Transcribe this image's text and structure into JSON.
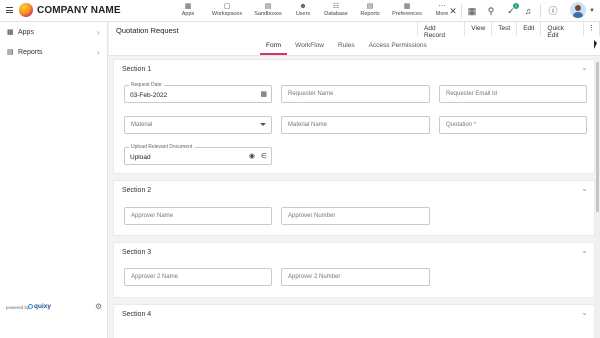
{
  "app": {
    "brand": "COMPANY NAME"
  },
  "topnav": [
    {
      "label": "Apps",
      "icon": "apps-icon"
    },
    {
      "label": "Workspaces",
      "icon": "workspaces-icon"
    },
    {
      "label": "Sandboxes",
      "icon": "sandboxes-icon"
    },
    {
      "label": "Users",
      "icon": "users-icon"
    },
    {
      "label": "Database",
      "icon": "database-icon"
    },
    {
      "label": "Reports",
      "icon": "reports-icon"
    },
    {
      "label": "Preferences",
      "icon": "preferences-icon"
    },
    {
      "label": "More",
      "icon": "more-icon"
    }
  ],
  "topbar_badge": "1",
  "sidebar": {
    "items": [
      {
        "label": "Apps",
        "icon": "apps-icon"
      },
      {
        "label": "Reports",
        "icon": "reports-icon"
      }
    ],
    "powered_by": "powered by",
    "powered_brand": "quixy"
  },
  "page": {
    "title": "Quotation Request",
    "actions": [
      "Add Record",
      "View",
      "Test",
      "Edit",
      "Quick Edit"
    ],
    "tabs": [
      "Form",
      "WorkFlow",
      "Rules",
      "Access Permissions"
    ]
  },
  "sections": [
    {
      "title": "Section 1",
      "fields": {
        "request_date_label": "Request Date",
        "request_date_value": "03-Feb-2022",
        "requester_name": "Requester Name",
        "requester_email": "Requester Email Id",
        "material_select": "Material",
        "material_name": "Material Name",
        "quotation": "Quotation *",
        "upload_label": "Upload Relevant Document",
        "upload_value": "Upload"
      }
    },
    {
      "title": "Section 2",
      "fields": {
        "approver_name": "Approver Name",
        "approver_number": "Approver Number"
      }
    },
    {
      "title": "Section 3",
      "fields": {
        "approver2_name": "Approver 2 Name",
        "approver2_number": "Approver 2 Number"
      }
    },
    {
      "title": "Section 4"
    }
  ],
  "colors": {
    "accent": "#d6336c",
    "brand_gradient_start": "#ffd23a",
    "brand_gradient_end": "#a3127c"
  }
}
